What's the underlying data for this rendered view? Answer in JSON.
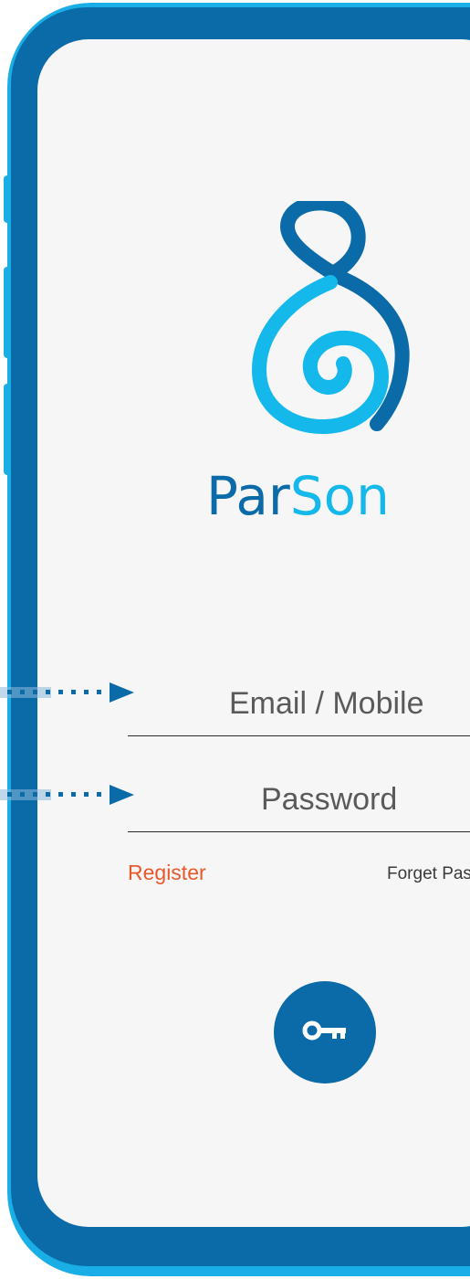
{
  "brand": {
    "name_part1": "Par",
    "name_part2": "Son",
    "logo_icon": "parson-logo-icon",
    "primary_color": "#0b6aa8",
    "secondary_color": "#14b8ea"
  },
  "login_form": {
    "email_placeholder": "Email / Mobile",
    "password_placeholder": "Password",
    "register_label": "Register",
    "forget_password_label": "Forget Pas",
    "submit_icon": "key-icon"
  },
  "colors": {
    "frame_outer": "#1aaee6",
    "frame_body": "#0b6aa8",
    "screen_bg": "#f6f6f6",
    "register_link": "#e8582a"
  }
}
